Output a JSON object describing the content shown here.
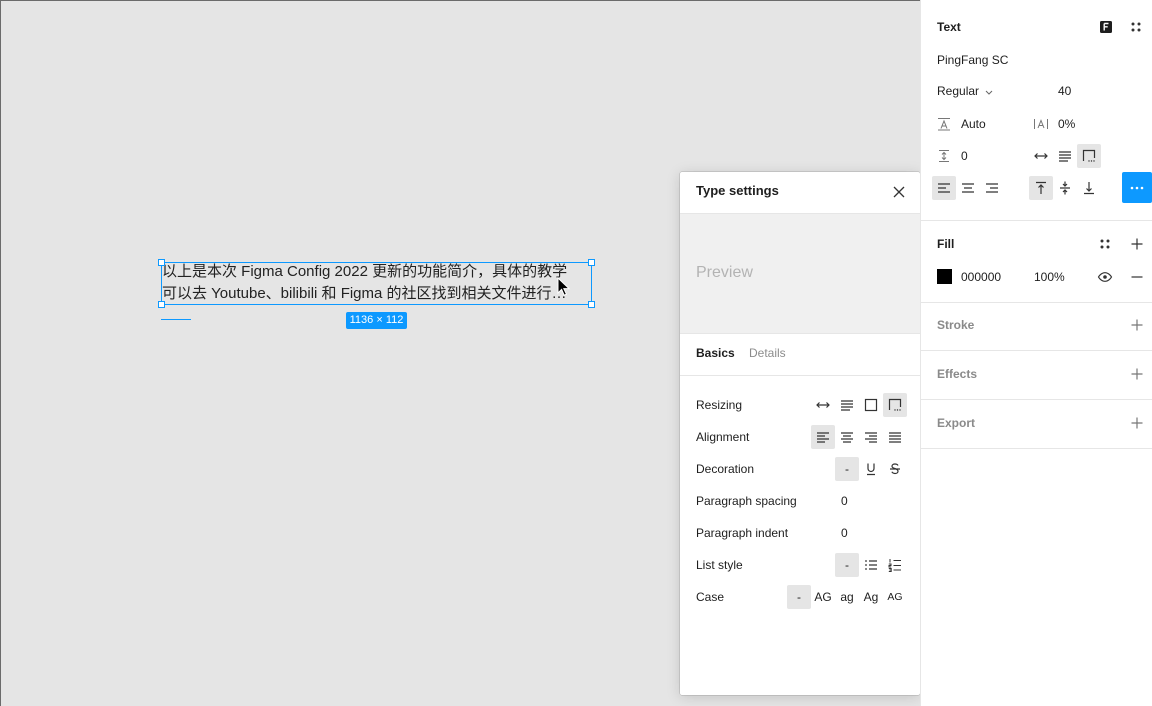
{
  "theme": {
    "accent": "#0d99ff",
    "canvas_bg": "#e5e5e5",
    "panel_bg": "#ffffff",
    "selected_bg": "#e5e5e5"
  },
  "canvas": {
    "text_layer": {
      "line_1": "以上是本次 Figma Config 2022 更新的功能简介，具体的教学",
      "line_2": "可以去 Youtube、bilibili 和 Figma 的社区找到相关文件进行…",
      "size_badge": "1136 × 112"
    },
    "cursor_icon": "mouse-cursor-icon"
  },
  "type_settings": {
    "title": "Type settings",
    "close_icon": "close-icon",
    "preview_label": "Preview",
    "tabs": [
      {
        "label": "Basics",
        "active": true
      },
      {
        "label": "Details",
        "active": false
      }
    ],
    "resizing": {
      "label": "Resizing",
      "options": [
        {
          "icon": "auto-width-icon",
          "selected": false
        },
        {
          "icon": "auto-height-icon",
          "selected": false
        },
        {
          "icon": "fixed-size-icon",
          "selected": false
        },
        {
          "icon": "truncate-text-icon",
          "selected": true
        }
      ]
    },
    "alignment": {
      "label": "Alignment",
      "options": [
        {
          "icon": "align-left-icon",
          "selected": true
        },
        {
          "icon": "align-center-icon",
          "selected": false
        },
        {
          "icon": "align-right-icon",
          "selected": false
        },
        {
          "icon": "align-justify-icon",
          "selected": false
        }
      ]
    },
    "decoration": {
      "label": "Decoration",
      "none_label": "-",
      "none_selected": true,
      "options": [
        {
          "icon": "underline-icon",
          "selected": false
        },
        {
          "icon": "strikethrough-icon",
          "selected": false
        }
      ]
    },
    "paragraph_spacing": {
      "label": "Paragraph spacing",
      "value": "0"
    },
    "paragraph_indent": {
      "label": "Paragraph indent",
      "value": "0"
    },
    "list_style": {
      "label": "List style",
      "none_label": "-",
      "none_selected": true,
      "options": [
        {
          "icon": "bulleted-list-icon",
          "selected": false
        },
        {
          "icon": "numbered-list-icon",
          "selected": false
        }
      ]
    },
    "case": {
      "label": "Case",
      "none_label": "-",
      "none_selected": true,
      "options": [
        {
          "label": "AG",
          "selected": false
        },
        {
          "label": "ag",
          "selected": false
        },
        {
          "label": "Ag",
          "selected": false
        },
        {
          "label": "AG",
          "selected": false
        }
      ]
    }
  },
  "design_panel": {
    "text": {
      "heading": "Text",
      "header_icons": [
        "text-styles-icon",
        "style-grid-icon"
      ],
      "font_family": "PingFang SC",
      "font_weight": "Regular",
      "font_size": "40",
      "line_height": "Auto",
      "letter_spacing": "0%",
      "paragraph_spacing": "0",
      "resizing_options": [
        {
          "icon": "auto-width-icon",
          "selected": false
        },
        {
          "icon": "auto-height-icon",
          "selected": false
        },
        {
          "icon": "truncate-text-icon",
          "selected": true
        }
      ],
      "horizontal_align": [
        {
          "icon": "align-left-icon",
          "selected": true
        },
        {
          "icon": "align-center-icon",
          "selected": false
        },
        {
          "icon": "align-right-icon",
          "selected": false
        }
      ],
      "vertical_align": [
        {
          "icon": "align-top-icon",
          "selected": true
        },
        {
          "icon": "align-middle-icon",
          "selected": false
        },
        {
          "icon": "align-bottom-icon",
          "selected": false
        }
      ],
      "more_icon": "more-icon"
    },
    "fill": {
      "heading": "Fill",
      "swatch_color": "#000000",
      "hex": "000000",
      "opacity": "100%"
    },
    "stroke": {
      "heading": "Stroke"
    },
    "effects": {
      "heading": "Effects"
    },
    "export": {
      "heading": "Export"
    }
  }
}
